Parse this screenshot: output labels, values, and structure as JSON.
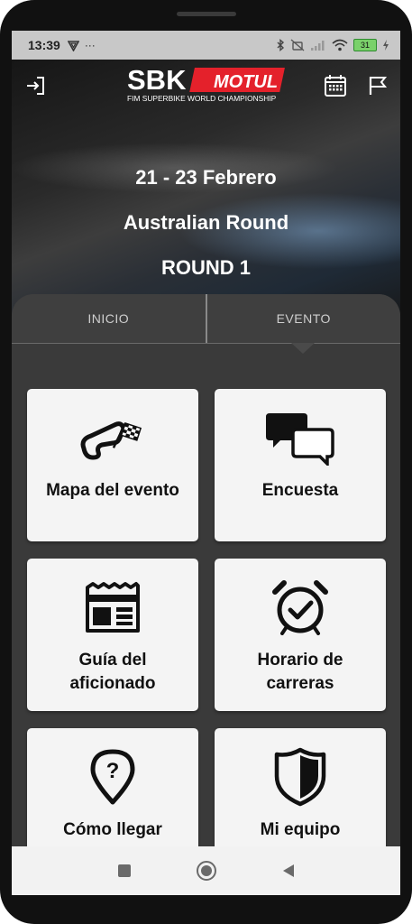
{
  "status_bar": {
    "time": "13:39",
    "left_icons": [
      "vpn-icon",
      "more-icon"
    ],
    "dots": "···",
    "right_icons": [
      "bluetooth-icon",
      "mute-icon",
      "signal-icon",
      "wifi-icon",
      "battery-icon"
    ],
    "battery_level": "31"
  },
  "header": {
    "logo_text": "SBK",
    "logo_sponsor": "MOTUL",
    "logo_subtitle": "FIM SUPERBIKE WORLD CHAMPIONSHIP",
    "left_icon": "logout-icon",
    "right_icons": [
      "calendar-icon",
      "flag-icon"
    ]
  },
  "event": {
    "dates": "21 - 23 Febrero",
    "name": "Australian Round",
    "round": "ROUND 1"
  },
  "tabs": [
    {
      "label": "INICIO",
      "active": false
    },
    {
      "label": "EVENTO",
      "active": true
    }
  ],
  "cards": [
    {
      "label": "Mapa del evento",
      "icon": "track-map-icon"
    },
    {
      "label": "Encuesta",
      "icon": "chat-bubbles-icon"
    },
    {
      "label": "Guía del aficionado",
      "icon": "newspaper-icon"
    },
    {
      "label": "Horario de carreras",
      "icon": "alarm-clock-icon"
    },
    {
      "label": "Cómo llegar",
      "icon": "location-question-icon"
    },
    {
      "label": "Mi equipo",
      "icon": "shield-icon"
    }
  ],
  "nav": [
    "recents-icon",
    "home-icon",
    "back-icon"
  ],
  "colors": {
    "accent_red": "#e4212b",
    "card_bg": "#f4f4f4",
    "panel_bg": "#3a3a3a"
  }
}
